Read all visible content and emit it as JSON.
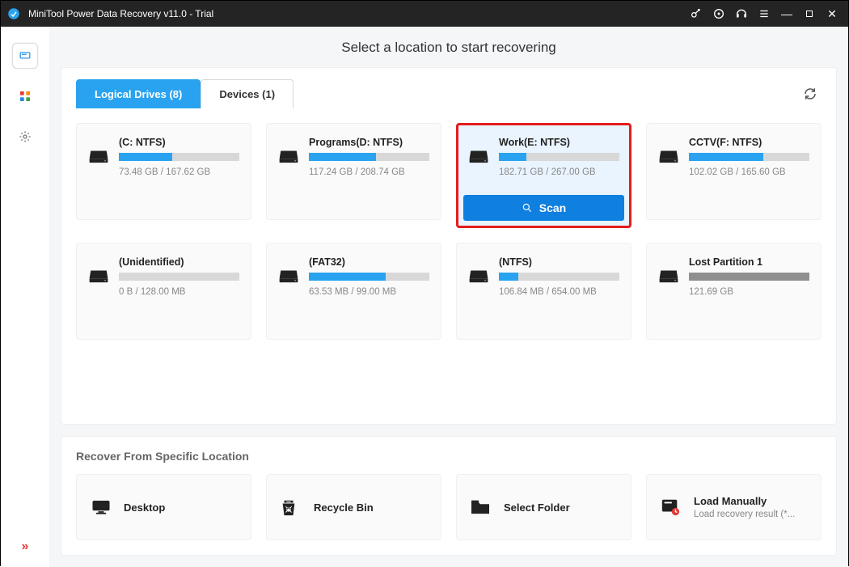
{
  "window": {
    "title": "MiniTool Power Data Recovery v11.0 - Trial"
  },
  "heading": "Select a location to start recovering",
  "tabs": {
    "logical": "Logical Drives (8)",
    "devices": "Devices (1)"
  },
  "scan_label": "Scan",
  "drives": [
    {
      "name": "(C: NTFS)",
      "usage": "73.48 GB / 167.62 GB",
      "pct": 44,
      "style": "blue"
    },
    {
      "name": "Programs(D: NTFS)",
      "usage": "117.24 GB / 208.74 GB",
      "pct": 56,
      "style": "blue"
    },
    {
      "name": "Work(E: NTFS)",
      "usage": "182.71 GB / 267.00 GB",
      "pct": 23,
      "style": "blue",
      "selected": true
    },
    {
      "name": "CCTV(F: NTFS)",
      "usage": "102.02 GB / 165.60 GB",
      "pct": 62,
      "style": "blue"
    },
    {
      "name": "(Unidentified)",
      "usage": "0 B / 128.00 MB",
      "pct": 0,
      "style": "blue"
    },
    {
      "name": "(FAT32)",
      "usage": "63.53 MB / 99.00 MB",
      "pct": 64,
      "style": "blue"
    },
    {
      "name": "(NTFS)",
      "usage": "106.84 MB / 654.00 MB",
      "pct": 16,
      "style": "blue"
    },
    {
      "name": "Lost Partition 1",
      "usage": "121.69 GB",
      "pct": 100,
      "style": "grey"
    }
  ],
  "specific": {
    "title": "Recover From Specific Location",
    "items": [
      {
        "label": "Desktop"
      },
      {
        "label": "Recycle Bin"
      },
      {
        "label": "Select Folder"
      },
      {
        "label": "Load Manually",
        "sub": "Load recovery result (*..."
      }
    ]
  }
}
